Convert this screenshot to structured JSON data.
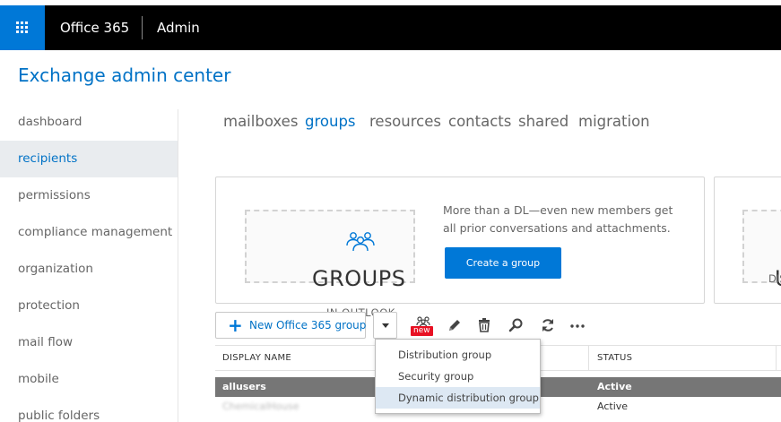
{
  "topbar": {
    "brand": "Office 365",
    "section": "Admin",
    "colors": {
      "bar": "#000000",
      "waffle": "#0078d7"
    }
  },
  "app_title": "Exchange admin center",
  "nav": {
    "items": [
      {
        "label": "dashboard",
        "active": false
      },
      {
        "label": "recipients",
        "active": true
      },
      {
        "label": "permissions",
        "active": false
      },
      {
        "label": "compliance management",
        "active": false
      },
      {
        "label": "organization",
        "active": false
      },
      {
        "label": "protection",
        "active": false
      },
      {
        "label": "mail flow",
        "active": false
      },
      {
        "label": "mobile",
        "active": false
      },
      {
        "label": "public folders",
        "active": false
      }
    ]
  },
  "tabs": [
    {
      "label": "mailboxes",
      "active": false
    },
    {
      "label": "groups",
      "active": true
    },
    {
      "label": "resources",
      "active": false
    },
    {
      "label": "contacts",
      "active": false
    },
    {
      "label": "shared",
      "active": false
    },
    {
      "label": "migration",
      "active": false
    }
  ],
  "promo": {
    "icon": "people-icon",
    "title": "GROUPS",
    "subtitle": "IN OUTLOOK",
    "description": "More than a DL—even new members get all prior conversations and attachments.",
    "button": "Create a group"
  },
  "promo2": {
    "title": "U",
    "subtitle": "DIS"
  },
  "toolbar": {
    "new_label": "New Office 365 group",
    "badge": "new",
    "icons": [
      "upgrade-icon",
      "edit-icon",
      "delete-icon",
      "search-icon",
      "refresh-icon",
      "more-icon"
    ]
  },
  "table": {
    "headers": [
      "DISPLAY NAME",
      "STATUS"
    ],
    "rows": [
      {
        "name": "allusers",
        "status": "Active",
        "selected": true
      },
      {
        "name": "ChemicalHouse",
        "status": "Active",
        "selected": false
      }
    ]
  },
  "dropdown_menu": {
    "items": [
      {
        "label": "Distribution group",
        "hover": false
      },
      {
        "label": "Security group",
        "hover": false
      },
      {
        "label": "Dynamic distribution group",
        "hover": true
      }
    ]
  }
}
